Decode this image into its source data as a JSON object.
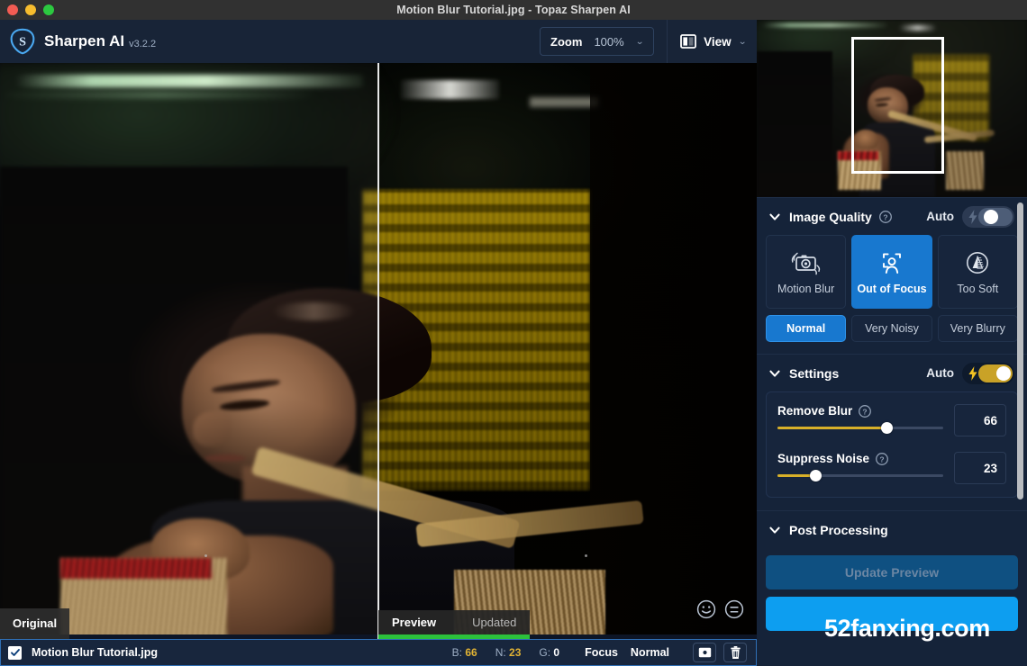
{
  "window": {
    "title": "Motion Blur Tutorial.jpg - Topaz Sharpen AI",
    "traffic_lights": [
      "close",
      "minimize",
      "maximize"
    ]
  },
  "toolbar": {
    "brand_name": "Sharpen AI",
    "version": "v3.2.2",
    "zoom_label": "Zoom",
    "zoom_value": "100%",
    "view_label": "View"
  },
  "canvas": {
    "original_label": "Original",
    "preview_tab": "Preview",
    "updated_tab": "Updated",
    "feedback_icons": [
      "smiley-face-icon",
      "neutral-face-icon"
    ]
  },
  "right_panel": {
    "image_quality": {
      "title": "Image Quality",
      "auto_label": "Auto",
      "auto_on": false,
      "modes": [
        {
          "label": "Motion Blur",
          "icon": "camera-shake-icon",
          "selected": false
        },
        {
          "label": "Out of Focus",
          "icon": "focus-person-icon",
          "selected": true
        },
        {
          "label": "Too Soft",
          "icon": "soft-cone-icon",
          "selected": false
        }
      ],
      "noise_levels": [
        {
          "label": "Normal",
          "selected": true
        },
        {
          "label": "Very Noisy",
          "selected": false
        },
        {
          "label": "Very Blurry",
          "selected": false
        }
      ]
    },
    "settings": {
      "title": "Settings",
      "auto_label": "Auto",
      "auto_on": true,
      "sliders": [
        {
          "name": "Remove Blur",
          "value": "66",
          "percent": 66
        },
        {
          "name": "Suppress Noise",
          "value": "23",
          "percent": 23
        }
      ]
    },
    "post_processing": {
      "title": "Post Processing",
      "update_preview_label": "Update Preview",
      "save_label": ""
    }
  },
  "watermark": "52fanxing.com",
  "file_bar": {
    "checked": true,
    "file_name": "Motion Blur Tutorial.jpg",
    "stats": [
      {
        "key": "B:",
        "value": "66",
        "highlight": true
      },
      {
        "key": "N:",
        "value": "23",
        "highlight": true
      },
      {
        "key": "G:",
        "value": "0",
        "highlight": false
      }
    ],
    "focus_label": "Focus",
    "focus_mode": "Normal",
    "buttons": [
      "compare-view-icon",
      "trash-icon"
    ]
  },
  "colors": {
    "accent_blue": "#1878cf",
    "save_blue": "#0d9ef0",
    "slider_gold": "#d8b029",
    "toggle_gold": "#c9a227",
    "panel_bg": "#152339",
    "progress_green": "#2cc13c"
  }
}
